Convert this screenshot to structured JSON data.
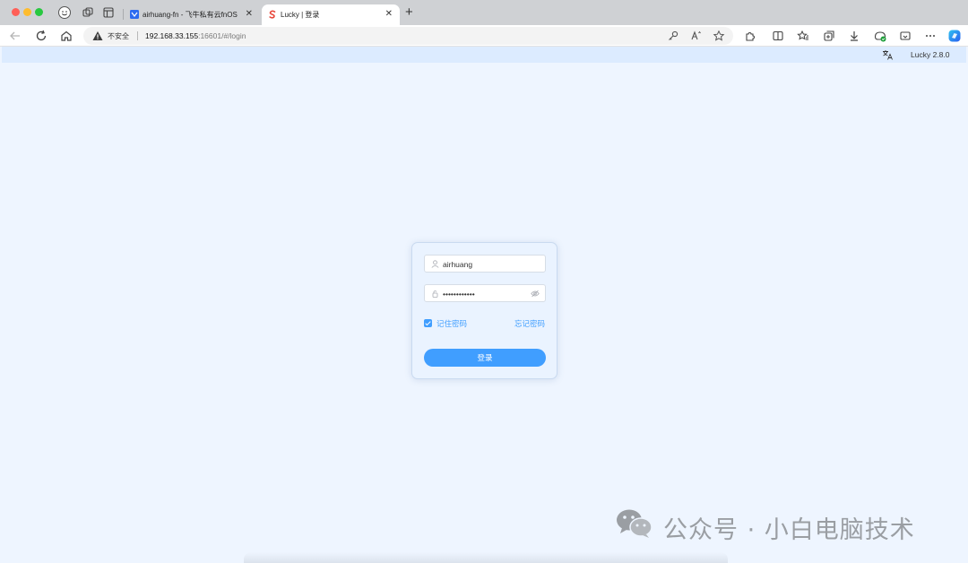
{
  "browser": {
    "tabs": [
      {
        "title": "airhuang-fn - 飞牛私有云fnOS",
        "close": "✕"
      },
      {
        "title": "Lucky | 登录",
        "close": "✕"
      }
    ],
    "new_tab": "+",
    "address": {
      "security_label": "不安全",
      "url_host": "192.168.33.155",
      "url_rest": ":16601/#/login"
    }
  },
  "app": {
    "version": "Lucky 2.8.0",
    "login": {
      "username": "airhuang",
      "password": "••••••••••••",
      "remember_label": "记住密码",
      "forgot_label": "忘记密码",
      "submit_label": "登录"
    }
  },
  "watermark": {
    "text": "公众号 · 小白电脑技术"
  },
  "colors": {
    "accent": "#409eff",
    "page_bg": "#eef5ff",
    "header_bg": "#dcebff"
  }
}
